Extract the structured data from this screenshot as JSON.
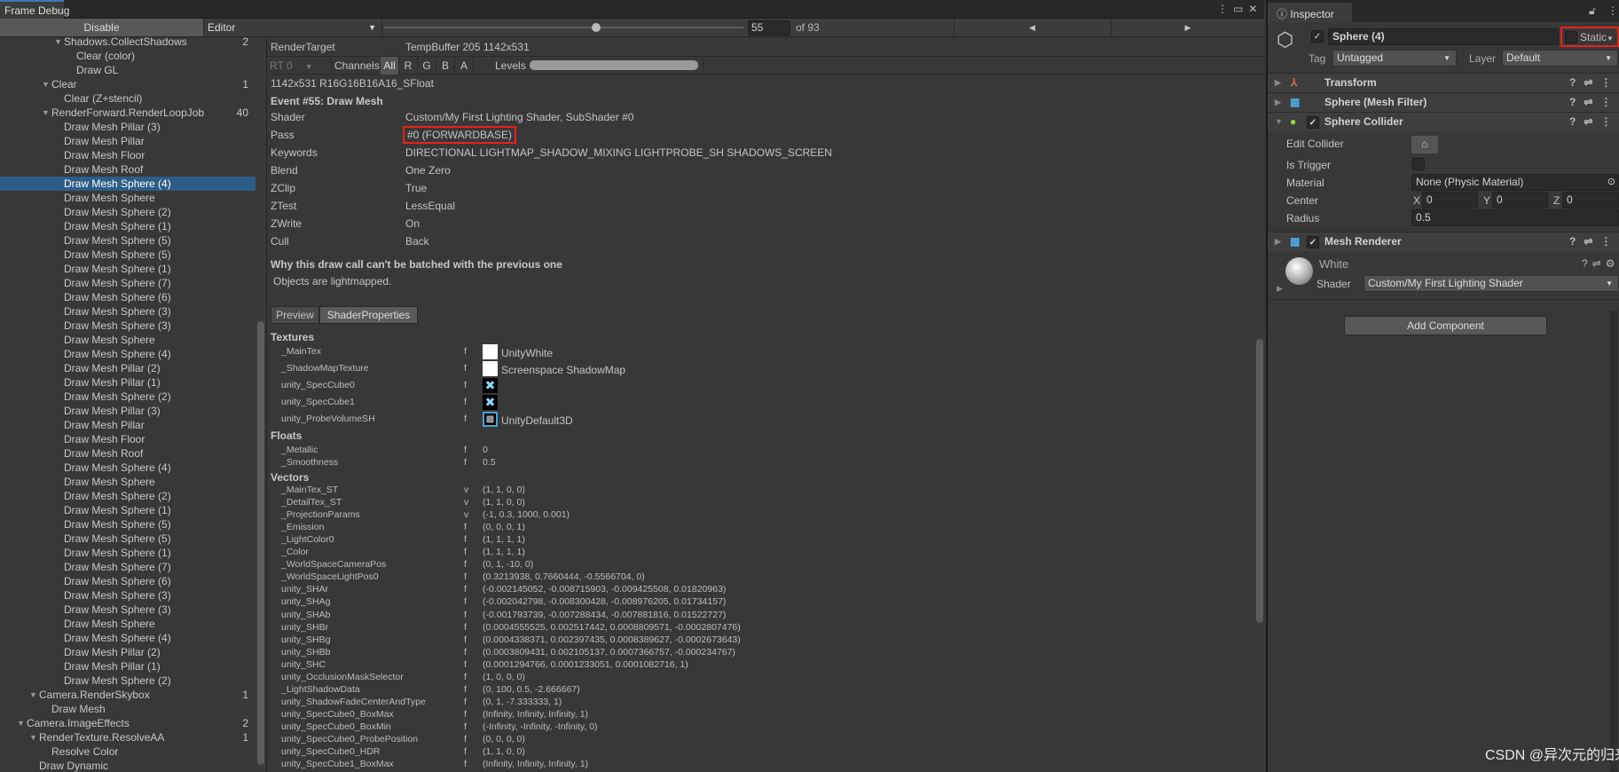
{
  "window": {
    "tab": "Frame Debug"
  },
  "toolbar": {
    "disable": "Disable",
    "target": "Editor",
    "event_index": "55",
    "event_total": "of 93",
    "slider_fraction": 0.59
  },
  "tree": [
    {
      "label": "Shadows.CollectShadows",
      "depth": 3,
      "expanded": true,
      "count": "2"
    },
    {
      "label": "Clear (color)",
      "depth": 4
    },
    {
      "label": "Draw GL",
      "depth": 4
    },
    {
      "label": "Clear",
      "depth": 2,
      "expanded": true,
      "count": "1"
    },
    {
      "label": "Clear (Z+stencil)",
      "depth": 3
    },
    {
      "label": "RenderForward.RenderLoopJob",
      "depth": 2,
      "expanded": true,
      "count": "40"
    },
    {
      "label": "Draw Mesh Pillar (3)",
      "depth": 3
    },
    {
      "label": "Draw Mesh Pillar",
      "depth": 3
    },
    {
      "label": "Draw Mesh Floor",
      "depth": 3
    },
    {
      "label": "Draw Mesh Roof",
      "depth": 3
    },
    {
      "label": "Draw Mesh Sphere (4)",
      "depth": 3,
      "selected": true
    },
    {
      "label": "Draw Mesh Sphere",
      "depth": 3
    },
    {
      "label": "Draw Mesh Sphere (2)",
      "depth": 3
    },
    {
      "label": "Draw Mesh Sphere (1)",
      "depth": 3
    },
    {
      "label": "Draw Mesh Sphere (5)",
      "depth": 3
    },
    {
      "label": "Draw Mesh Sphere (5)",
      "depth": 3
    },
    {
      "label": "Draw Mesh Sphere (1)",
      "depth": 3
    },
    {
      "label": "Draw Mesh Sphere (7)",
      "depth": 3
    },
    {
      "label": "Draw Mesh Sphere (6)",
      "depth": 3
    },
    {
      "label": "Draw Mesh Sphere (3)",
      "depth": 3
    },
    {
      "label": "Draw Mesh Sphere (3)",
      "depth": 3
    },
    {
      "label": "Draw Mesh Sphere",
      "depth": 3
    },
    {
      "label": "Draw Mesh Sphere (4)",
      "depth": 3
    },
    {
      "label": "Draw Mesh Pillar (2)",
      "depth": 3
    },
    {
      "label": "Draw Mesh Pillar (1)",
      "depth": 3
    },
    {
      "label": "Draw Mesh Sphere (2)",
      "depth": 3
    },
    {
      "label": "Draw Mesh Pillar (3)",
      "depth": 3
    },
    {
      "label": "Draw Mesh Pillar",
      "depth": 3
    },
    {
      "label": "Draw Mesh Floor",
      "depth": 3
    },
    {
      "label": "Draw Mesh Roof",
      "depth": 3
    },
    {
      "label": "Draw Mesh Sphere (4)",
      "depth": 3
    },
    {
      "label": "Draw Mesh Sphere",
      "depth": 3
    },
    {
      "label": "Draw Mesh Sphere (2)",
      "depth": 3
    },
    {
      "label": "Draw Mesh Sphere (1)",
      "depth": 3
    },
    {
      "label": "Draw Mesh Sphere (5)",
      "depth": 3
    },
    {
      "label": "Draw Mesh Sphere (5)",
      "depth": 3
    },
    {
      "label": "Draw Mesh Sphere (1)",
      "depth": 3
    },
    {
      "label": "Draw Mesh Sphere (7)",
      "depth": 3
    },
    {
      "label": "Draw Mesh Sphere (6)",
      "depth": 3
    },
    {
      "label": "Draw Mesh Sphere (3)",
      "depth": 3
    },
    {
      "label": "Draw Mesh Sphere (3)",
      "depth": 3
    },
    {
      "label": "Draw Mesh Sphere",
      "depth": 3
    },
    {
      "label": "Draw Mesh Sphere (4)",
      "depth": 3
    },
    {
      "label": "Draw Mesh Pillar (2)",
      "depth": 3
    },
    {
      "label": "Draw Mesh Pillar (1)",
      "depth": 3
    },
    {
      "label": "Draw Mesh Sphere (2)",
      "depth": 3
    },
    {
      "label": "Camera.RenderSkybox",
      "depth": 1,
      "expanded": true,
      "count": "1"
    },
    {
      "label": "Draw Mesh",
      "depth": 2
    },
    {
      "label": "Camera.ImageEffects",
      "depth": 0,
      "expanded": true,
      "count": "2"
    },
    {
      "label": "RenderTexture.ResolveAA",
      "depth": 1,
      "expanded": true,
      "count": "1"
    },
    {
      "label": "Resolve Color",
      "depth": 2
    },
    {
      "label": "Draw Dynamic",
      "depth": 1
    }
  ],
  "details": {
    "render_target_label": "RenderTarget",
    "render_target": "TempBuffer 205 1142x531",
    "rt": "RT 0",
    "channels": "Channels",
    "ch": [
      "All",
      "R",
      "G",
      "B",
      "A"
    ],
    "levels": "Levels",
    "format": "1142x531 R16G16B16A16_SFloat",
    "event": "Event #55: Draw Mesh",
    "props": [
      {
        "k": "Shader",
        "v": "Custom/My First Lighting Shader, SubShader #0"
      },
      {
        "k": "Pass",
        "v": "#0 (FORWARDBASE)",
        "highlight": true
      },
      {
        "k": "Keywords",
        "v": "DIRECTIONAL LIGHTMAP_SHADOW_MIXING LIGHTPROBE_SH SHADOWS_SCREEN"
      },
      {
        "k": "Blend",
        "v": "One Zero"
      },
      {
        "k": "ZClip",
        "v": "True"
      },
      {
        "k": "ZTest",
        "v": "LessEqual"
      },
      {
        "k": "ZWrite",
        "v": "On"
      },
      {
        "k": "Cull",
        "v": "Back"
      }
    ],
    "batch_title": "Why this draw call can't be batched with the previous one",
    "batch_reason": "Objects are lightmapped.",
    "tabs": [
      "Preview",
      "ShaderProperties"
    ],
    "textures_header": "Textures",
    "textures": [
      {
        "n": "_MainTex",
        "t": "f",
        "v": "UnityWhite",
        "icon": "white"
      },
      {
        "n": "_ShadowMapTexture",
        "t": "f",
        "v": "Screenspace ShadowMap",
        "icon": "white"
      },
      {
        "n": "unity_SpecCube0",
        "t": "f",
        "v": "",
        "icon": "cube"
      },
      {
        "n": "unity_SpecCube1",
        "t": "f",
        "v": "",
        "icon": "cube"
      },
      {
        "n": "unity_ProbeVolumeSH",
        "t": "f",
        "v": "UnityDefault3D",
        "icon": "3d"
      }
    ],
    "floats_header": "Floats",
    "floats": [
      {
        "n": "_Metallic",
        "t": "f",
        "v": "0"
      },
      {
        "n": "_Smoothness",
        "t": "f",
        "v": "0.5"
      }
    ],
    "vectors_header": "Vectors",
    "vectors": [
      {
        "n": "_MainTex_ST",
        "t": "v",
        "v": "(1, 1, 0, 0)"
      },
      {
        "n": "_DetailTex_ST",
        "t": "v",
        "v": "(1, 1, 0, 0)"
      },
      {
        "n": "_ProjectionParams",
        "t": "v",
        "v": "(-1, 0.3, 1000, 0.001)"
      },
      {
        "n": "_Emission",
        "t": "f",
        "v": "(0, 0, 0, 1)"
      },
      {
        "n": "_LightColor0",
        "t": "f",
        "v": "(1, 1, 1, 1)"
      },
      {
        "n": "_Color",
        "t": "f",
        "v": "(1, 1, 1, 1)"
      },
      {
        "n": "_WorldSpaceCameraPos",
        "t": "f",
        "v": "(0, 1, -10, 0)"
      },
      {
        "n": "_WorldSpaceLightPos0",
        "t": "f",
        "v": "(0.3213938, 0.7660444, -0.5566704, 0)"
      },
      {
        "n": "unity_SHAr",
        "t": "f",
        "v": "(-0.002145052, -0.008715903, -0.009425508, 0.01820963)"
      },
      {
        "n": "unity_SHAg",
        "t": "f",
        "v": "(-0.002042798, -0.008300428, -0.008976205, 0.01734157)"
      },
      {
        "n": "unity_SHAb",
        "t": "f",
        "v": "(-0.001793739, -0.007288434, -0.007881816, 0.01522727)"
      },
      {
        "n": "unity_SHBr",
        "t": "f",
        "v": "(0.0004555525, 0.002517442, 0.0008809571, -0.0002807476)"
      },
      {
        "n": "unity_SHBg",
        "t": "f",
        "v": "(0.0004338371, 0.002397435, 0.0008389627, -0.0002673643)"
      },
      {
        "n": "unity_SHBb",
        "t": "f",
        "v": "(0.0003809431, 0.002105137, 0.0007366757, -0.000234767)"
      },
      {
        "n": "unity_SHC",
        "t": "f",
        "v": "(0.0001294766, 0.0001233051, 0.0001082716, 1)"
      },
      {
        "n": "unity_OcclusionMaskSelector",
        "t": "f",
        "v": "(1, 0, 0, 0)"
      },
      {
        "n": "_LightShadowData",
        "t": "f",
        "v": "(0, 100, 0.5, -2.666667)"
      },
      {
        "n": "unity_ShadowFadeCenterAndType",
        "t": "f",
        "v": "(0, 1, -7.333333, 1)"
      },
      {
        "n": "unity_SpecCube0_BoxMax",
        "t": "f",
        "v": "(Infinity, Infinity, Infinity, 1)"
      },
      {
        "n": "unity_SpecCube0_BoxMin",
        "t": "f",
        "v": "(-Infinity, -Infinity, -Infinity, 0)"
      },
      {
        "n": "unity_SpecCube0_ProbePosition",
        "t": "f",
        "v": "(0, 0, 0, 0)"
      },
      {
        "n": "unity_SpecCube0_HDR",
        "t": "f",
        "v": "(1, 1, 0, 0)"
      },
      {
        "n": "unity_SpecCube1_BoxMax",
        "t": "f",
        "v": "(Infinity, Infinity, Infinity, 1)"
      }
    ]
  },
  "inspector": {
    "tab": "Inspector",
    "object_name": "Sphere (4)",
    "active": true,
    "static": "Static",
    "tag_label": "Tag",
    "tag": "Untagged",
    "layer_label": "Layer",
    "layer": "Default",
    "components": {
      "transform": "Transform",
      "mesh_filter": "Sphere (Mesh Filter)",
      "collider": "Sphere Collider",
      "renderer": "Mesh Renderer"
    },
    "collider": {
      "edit_label": "Edit Collider",
      "trigger_label": "Is Trigger",
      "material_label": "Material",
      "material": "None (Physic Material)",
      "center_label": "Center",
      "x": "X",
      "cx": "0",
      "y": "Y",
      "cy": "0",
      "z": "Z",
      "cz": "0",
      "radius_label": "Radius",
      "radius": "0.5"
    },
    "material": {
      "name": "White",
      "shader_label": "Shader",
      "shader": "Custom/My First Lighting Shader"
    },
    "add_component": "Add Component"
  },
  "watermark": "CSDN @异次元的归来",
  "colors": {
    "selection": "#2c5d87",
    "highlight_box": "#e8221b",
    "tab_accent": "#3a79bb"
  }
}
